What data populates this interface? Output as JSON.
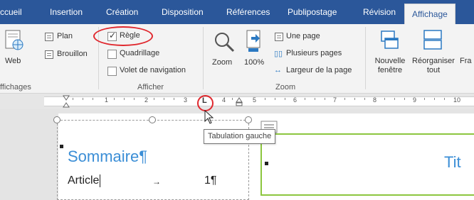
{
  "tabs": [
    "ccueil",
    "Insertion",
    "Création",
    "Disposition",
    "Références",
    "Publipostage",
    "Révision",
    "Affichage"
  ],
  "views": {
    "web_label": "Web",
    "plan_label": "Plan",
    "brouillon_label": "Brouillon",
    "group_label": "ffichages"
  },
  "show": {
    "regle_label": "Règle",
    "quadrillage_label": "Quadrillage",
    "volet_label": "Volet de navigation",
    "group_label": "Afficher"
  },
  "zoom": {
    "zoom_label": "Zoom",
    "pct_label": "100%",
    "une_page_label": "Une page",
    "plusieurs_label": "Plusieurs pages",
    "largeur_label": "Largeur de la page",
    "group_label": "Zoom"
  },
  "window": {
    "nouvelle_line1": "Nouvelle",
    "nouvelle_line2": "fenêtre",
    "reorg_line1": "Réorganiser",
    "reorg_line2": "tout",
    "fra_label": "Fra"
  },
  "ruler": {
    "numbers": [
      "1",
      "2",
      "3",
      "4",
      "5",
      "6",
      "7",
      "8",
      "9",
      "10"
    ]
  },
  "tooltip": "Tabulation gauche",
  "document": {
    "heading": "Sommaire¶",
    "article": "Article",
    "arrow": "→",
    "page_num": "1¶",
    "title_fragment": "Tit"
  },
  "colors": {
    "ribbon_tab_bg": "#2b579a",
    "heading_blue": "#3b8ed6",
    "annotation_red": "#e0282e",
    "box_green": "#8cc63f"
  }
}
